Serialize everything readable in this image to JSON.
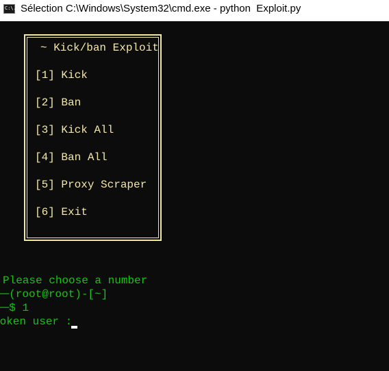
{
  "window": {
    "title": "Sélection C:\\Windows\\System32\\cmd.exe - python  Exploit.py",
    "icon_text": "C:\\."
  },
  "menu": {
    "title": "~ Kick/ban Exploit",
    "items": [
      {
        "label": "[1] Kick"
      },
      {
        "label": "[2] Ban"
      },
      {
        "label": "[3] Kick All"
      },
      {
        "label": "[4] Ban All"
      },
      {
        "label": "[5] Proxy Scraper"
      },
      {
        "label": "[6] Exit"
      }
    ]
  },
  "prompt": {
    "message": "Please choose a number",
    "line1": "┌─(root@root)-[~]",
    "line2": "└─$ 1",
    "input_label": "token user :"
  },
  "colors": {
    "menu_text": "#f3e8a8",
    "prompt_text": "#13c613",
    "background": "#0c0c0c"
  }
}
